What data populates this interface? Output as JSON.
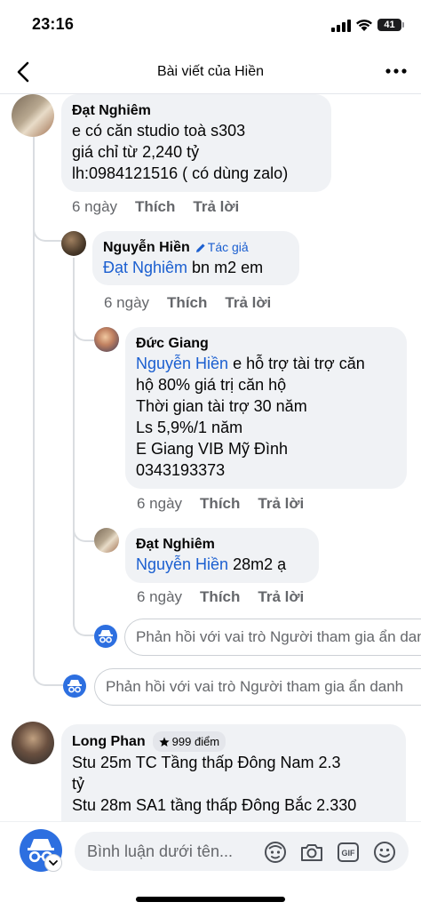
{
  "status_bar": {
    "time": "23:16",
    "battery": "41"
  },
  "header": {
    "title": "Bài viết của Hiền"
  },
  "comments": [
    {
      "author": "Đạt Nghiêm",
      "text": "e có căn studio toà s303\ngiá chỉ từ 2,240 tỷ\nlh:0984121516 ( có dùng zalo)",
      "time": "6 ngày",
      "like": "Thích",
      "reply": "Trả lời"
    },
    {
      "author": "Nguyễn Hiền",
      "badge": "Tác giả",
      "mention": "Đạt Nghiêm",
      "text": " bn m2 em",
      "time": "6 ngày",
      "like": "Thích",
      "reply": "Trả lời"
    },
    {
      "author": "Đức Giang",
      "mention": "Nguyễn Hiền",
      "text": " e hỗ trợ tài trợ căn\nhộ 80% giá trị căn hộ\nThời gian tài trợ 30 năm\nLs 5,9%/1 năm\nE Giang VIB Mỹ Đình\n0343193373",
      "time": "6 ngày",
      "like": "Thích",
      "reply": "Trả lời"
    },
    {
      "author": "Đạt Nghiêm",
      "mention": "Nguyễn Hiền",
      "text": " 28m2 ạ",
      "time": "6 ngày",
      "like": "Thích",
      "reply": "Trả lời"
    },
    {
      "author": "Long Phan",
      "points": "999 điểm",
      "text": "Stu 25m TC Tầng thấp Đông Nam 2.3\ntỷ\nStu 28m SA1 tầng thấp Đông Bắc 2.330"
    }
  ],
  "reply_inputs": {
    "nested_placeholder": "Phản hồi với vai trò Người tham gia ẩn danh",
    "thread_placeholder": "Phản hồi với vai trò Người tham gia ẩn danh"
  },
  "composer": {
    "placeholder": "Bình luận dưới tên..."
  },
  "icons": [
    "back-icon",
    "more-icon",
    "pencil-icon",
    "star-icon",
    "anonymous-icon",
    "avatar-icon",
    "camera-icon",
    "gif-icon",
    "emoji-icon"
  ],
  "colors": {
    "mention": "#1b5fd0",
    "anonymous": "#2d6fe0",
    "bubble": "#f0f2f5"
  }
}
